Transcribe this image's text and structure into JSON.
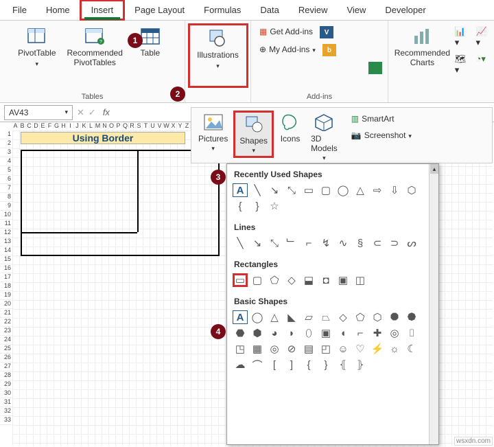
{
  "menu": {
    "items": [
      "File",
      "Home",
      "Insert",
      "Page Layout",
      "Formulas",
      "Data",
      "Review",
      "View",
      "Developer"
    ],
    "active": "Insert"
  },
  "ribbon": {
    "tables": {
      "label": "Tables",
      "pivot": "PivotTable",
      "recommended": "Recommended\nPivotTables",
      "table": "Table"
    },
    "illustrations": {
      "btn": "Illustrations",
      "label": ""
    },
    "addins": {
      "label": "Add-ins",
      "get": "Get Add-ins",
      "my": "My Add-ins"
    },
    "charts": {
      "recommended": "Recommended\nCharts"
    }
  },
  "sub": {
    "pictures": "Pictures",
    "shapes": "Shapes",
    "icons": "Icons",
    "models": "3D\nModels",
    "smartart": "SmartArt",
    "screenshot": "Screenshot"
  },
  "formula": {
    "namebox": "AV43"
  },
  "sheet": {
    "title": "Using Border"
  },
  "dd": {
    "recent": "Recently Used Shapes",
    "lines": "Lines",
    "rects": "Rectangles",
    "basic": "Basic Shapes"
  },
  "badges": {
    "b1": "1",
    "b2": "2",
    "b3": "3",
    "b4": "4"
  },
  "watermark": "wsxdn.com"
}
